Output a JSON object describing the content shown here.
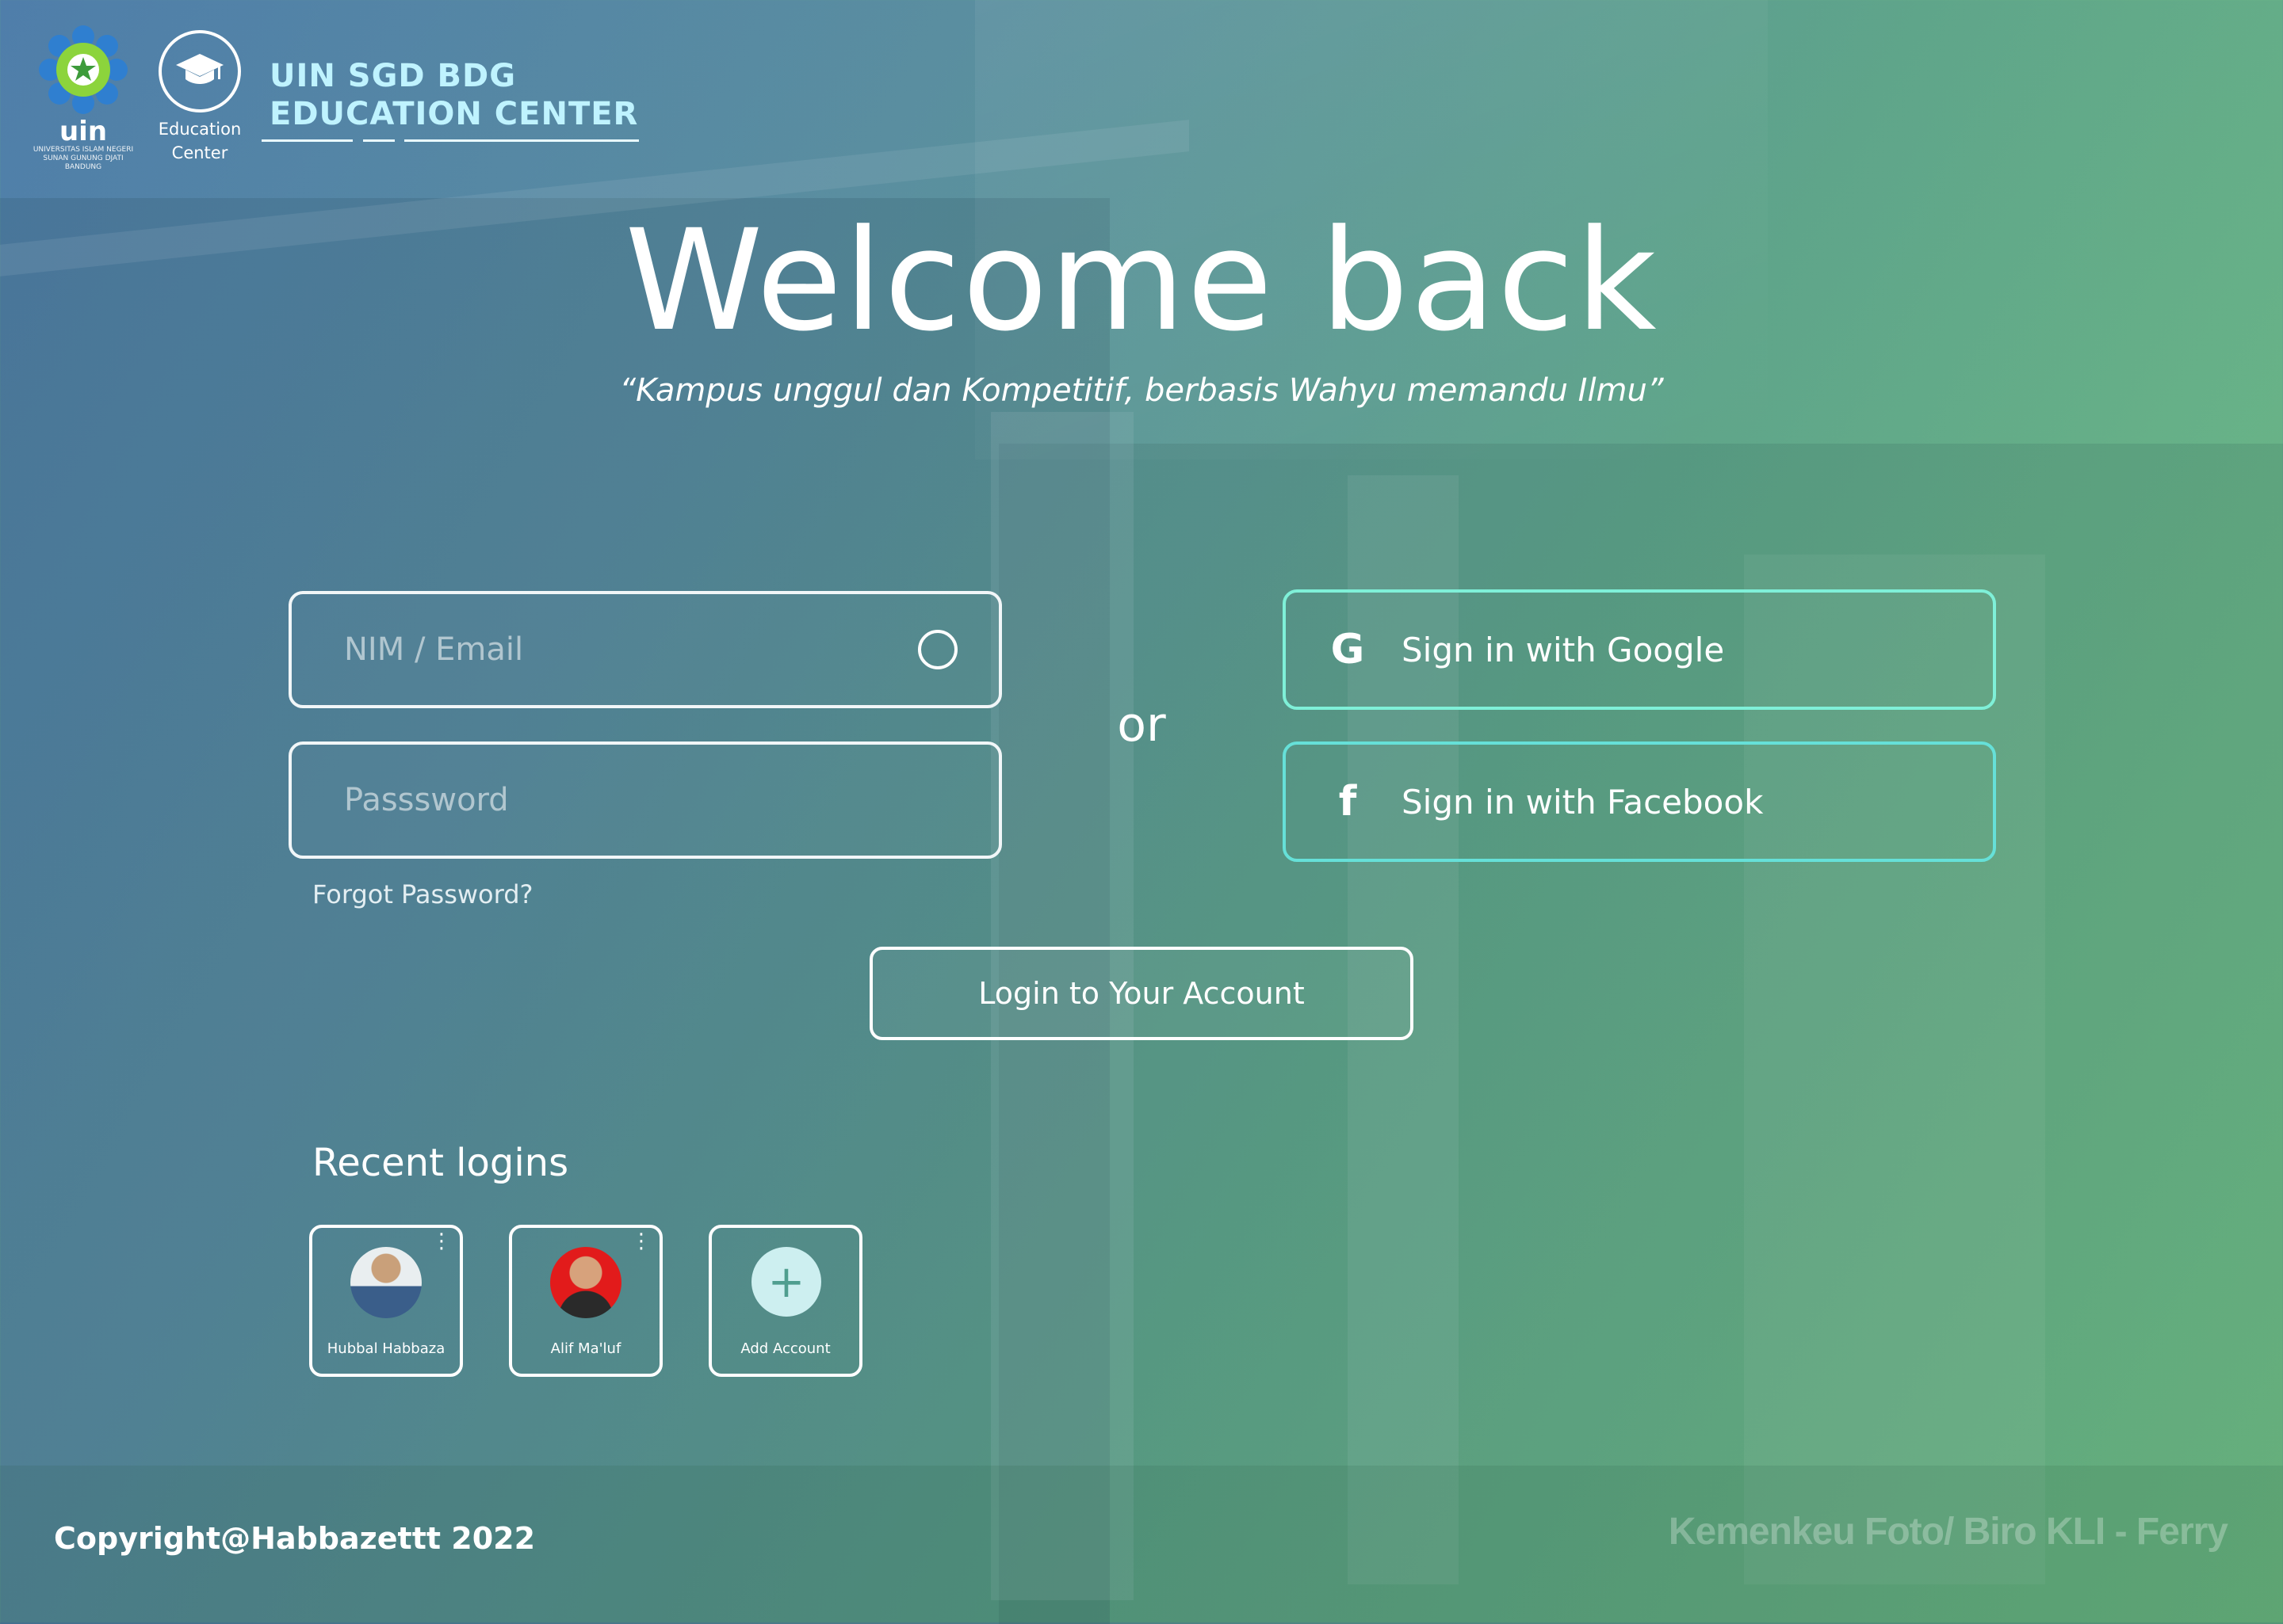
{
  "header": {
    "uin_logo_text": "uin",
    "uin_logo_sub": "UNIVERSITAS ISLAM NEGERI SUNAN GUNUNG DJATI BANDUNG",
    "edu_logo_label": "Education Center",
    "edu_logo_icon": "graduation-cap-icon",
    "brand_line1": "UIN SGD BDG",
    "brand_line2": "EDUCATION CENTER"
  },
  "hero": {
    "title": "Welcome back",
    "tagline": "“Kampus unggul dan Kompetitif, berbasis Wahyu memandu Ilmu”"
  },
  "form": {
    "nim_placeholder": "NIM / Email",
    "password_placeholder": "Passsword",
    "forgot_label": "Forgot Password?",
    "or_label": "or",
    "login_button": "Login to Your Account"
  },
  "social": {
    "google_label": "Sign in with Google",
    "google_icon": "google-icon",
    "facebook_label": "Sign in with Facebook",
    "facebook_icon": "facebook-icon"
  },
  "recent": {
    "title": "Recent logins",
    "accounts": [
      {
        "name": "Hubbal Habbaza"
      },
      {
        "name": "Alif Ma'luf"
      }
    ],
    "add_label": "Add Account"
  },
  "footer": {
    "copyright": "Copyright@Habbazettt 2022",
    "photo_credit": "Kemenkeu Foto/ Biro KLI - Ferry"
  },
  "colors": {
    "accent_border": "#7ff0d8",
    "brand_text": "#bff3ff",
    "gradient_start": "#4f7eaa",
    "gradient_end": "#72c284"
  }
}
